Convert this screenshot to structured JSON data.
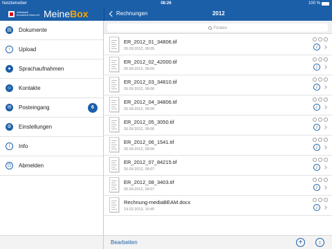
{
  "status": {
    "carrier": "Netzbetreiber",
    "time": "08:26",
    "battery": "100 %"
  },
  "brand": {
    "bank": "Volksbank Emmerich-Rees eG",
    "name_part1": "Meine",
    "name_part2": "Box"
  },
  "nav": {
    "back_label": "Rechnungen",
    "title": "2012"
  },
  "sidebar": {
    "items": [
      {
        "label": "Dokumente",
        "icon": "document-icon"
      },
      {
        "label": "Upload",
        "icon": "upload-icon"
      },
      {
        "label": "Sprachaufnahmen",
        "icon": "microphone-icon"
      },
      {
        "label": "Kontakte",
        "icon": "contacts-icon"
      },
      {
        "label": "Posteingang",
        "icon": "mail-icon",
        "badge": "6"
      },
      {
        "label": "Einstellungen",
        "icon": "gear-icon"
      },
      {
        "label": "Info",
        "icon": "info-icon"
      },
      {
        "label": "Abmelden",
        "icon": "power-icon"
      }
    ]
  },
  "search": {
    "placeholder": "Finden"
  },
  "files": [
    {
      "name": "ER_2012_01_34806.tif",
      "date": "26.09.2012, 09:05"
    },
    {
      "name": "ER_2012_02_42000.tif",
      "date": "26.09.2012, 09:06"
    },
    {
      "name": "ER_2012_03_34810.tif",
      "date": "26.09.2012, 09:06"
    },
    {
      "name": "ER_2012_04_34806.tif",
      "date": "26.09.2012, 09:06"
    },
    {
      "name": "ER_2012_05_3050.tif",
      "date": "26.09.2012, 09:06"
    },
    {
      "name": "ER_2012_06_1541.tif",
      "date": "26.09.2012, 09:06"
    },
    {
      "name": "ER_2012_07_84215.tif",
      "date": "26.09.2012, 09:07"
    },
    {
      "name": "ER_2012_08_3403.tif",
      "date": "26.09.2012, 09:07"
    },
    {
      "name": "Rechnung-mediaBEAM.docx",
      "date": "19.02.2013, 10:45"
    }
  ],
  "toolbar": {
    "edit_label": "Bearbeiten"
  },
  "colors": {
    "accent": "#1b5fa8",
    "brand_orange": "#f7a600"
  }
}
